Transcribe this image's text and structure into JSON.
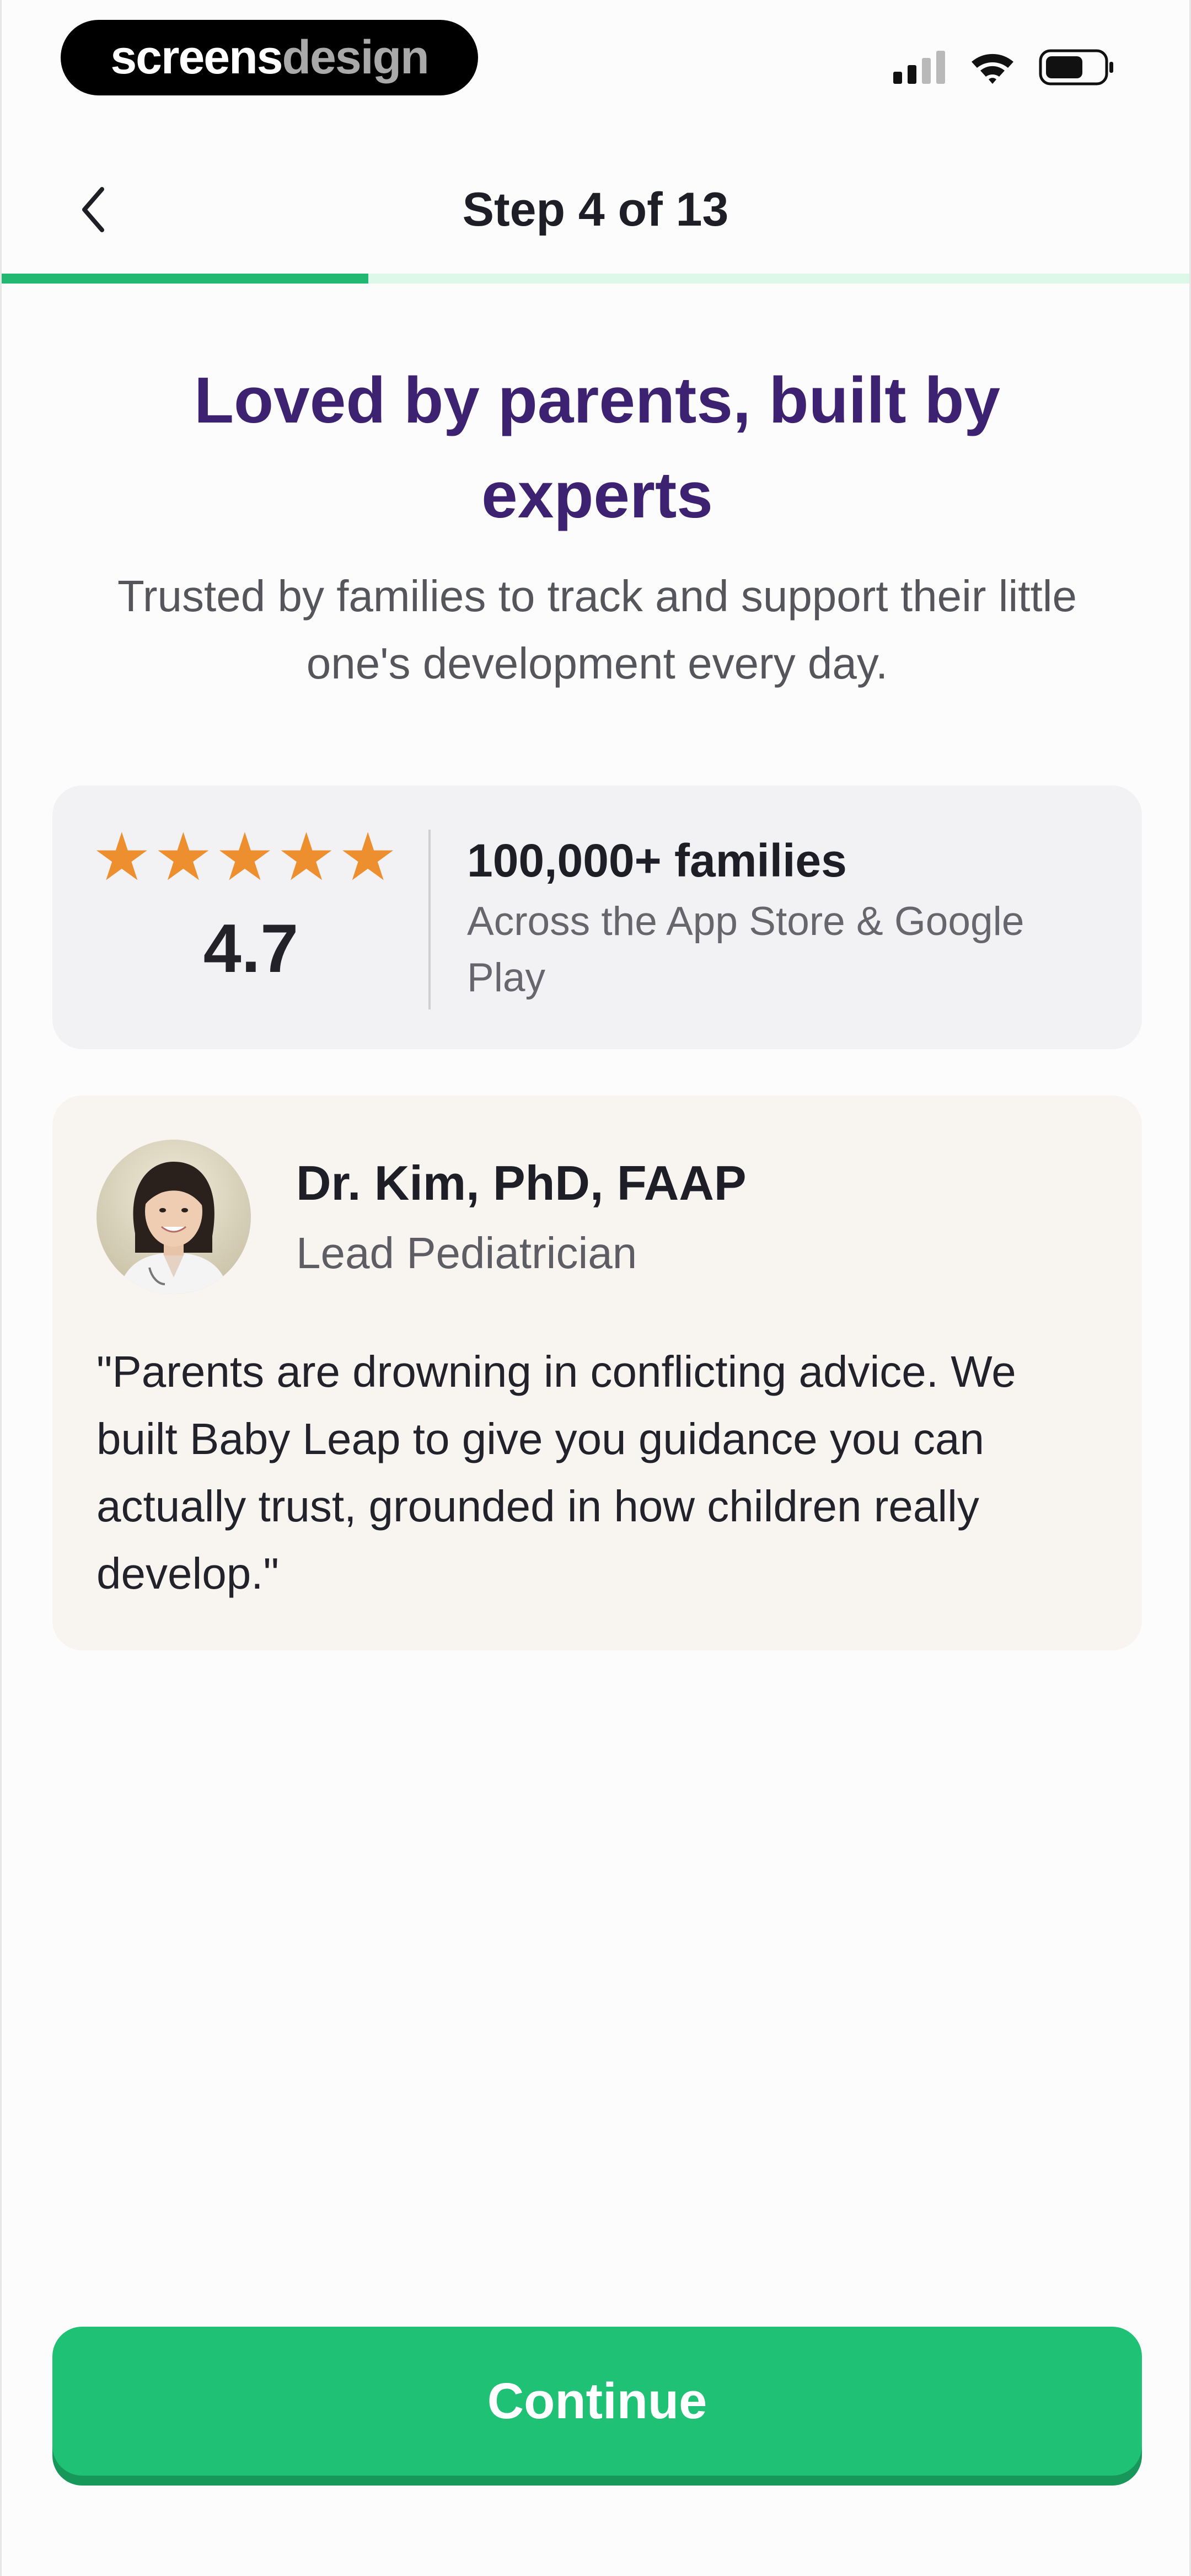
{
  "status_bar": {
    "brand_part1": "screens",
    "brand_part2": "design",
    "icons": [
      "cellular-signal-icon",
      "wifi-icon",
      "battery-icon"
    ]
  },
  "nav": {
    "back_icon": "chevron-left-icon",
    "step_title": "Step 4 of 13",
    "progress_step": 4,
    "progress_total": 13
  },
  "hero": {
    "headline": "Loved by parents, built by experts",
    "subheadline": "Trusted by families to track and support their little one's development every day."
  },
  "rating_card": {
    "stars": 5,
    "rating": "4.7",
    "families_title": "100,000+ families",
    "families_subtitle": "Across the App Store & Google Play"
  },
  "testimonial": {
    "name": "Dr. Kim, PhD, FAAP",
    "role": "Lead Pediatrician",
    "quote": "\"Parents are drowning in conflicting advice. We built Baby Leap to give you guidance you can actually trust, grounded in how children really develop.\""
  },
  "cta": {
    "continue_label": "Continue"
  },
  "colors": {
    "headline": "#3c2270",
    "accent_green": "#1fc175",
    "progress_fill": "#22b872",
    "progress_track": "#ddf7e8",
    "star": "#ee8f2f"
  }
}
